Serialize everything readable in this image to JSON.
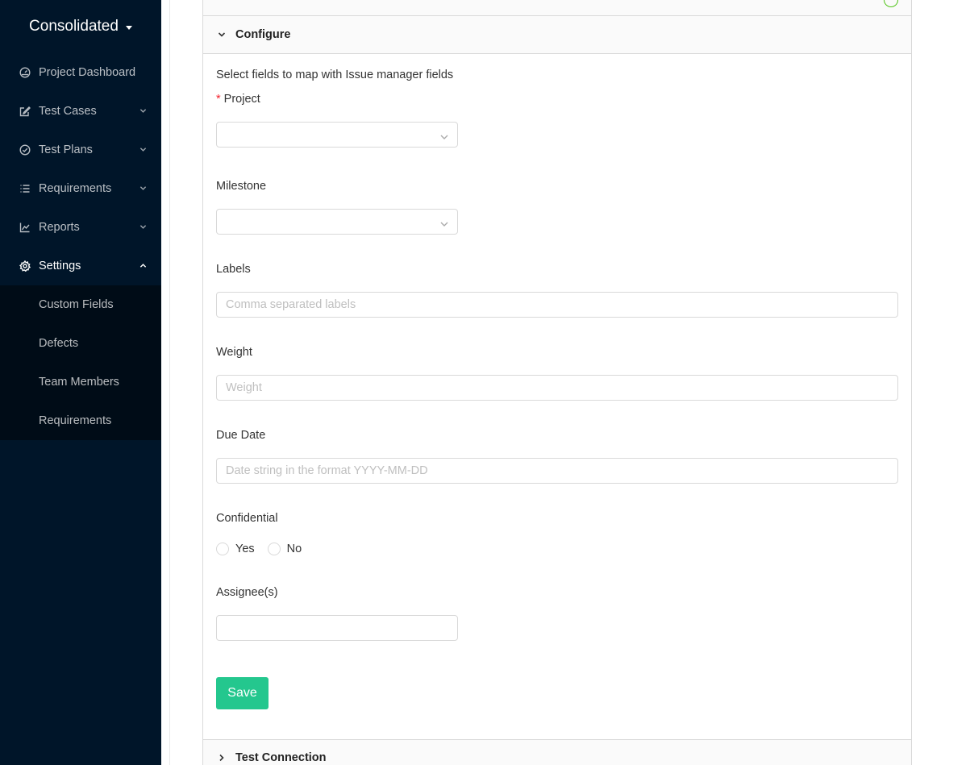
{
  "sidebar": {
    "workspace": "Consolidated",
    "items": [
      {
        "label": "Project Dashboard",
        "icon": "dashboard-icon"
      },
      {
        "label": "Test Cases",
        "icon": "edit-icon"
      },
      {
        "label": "Test Plans",
        "icon": "check-circle-icon"
      },
      {
        "label": "Requirements",
        "icon": "list-icon"
      },
      {
        "label": "Reports",
        "icon": "line-chart-icon"
      },
      {
        "label": "Settings",
        "icon": "gear-icon"
      }
    ],
    "settings_submenu": [
      "Custom Fields",
      "Defects",
      "Team Members",
      "Requirements"
    ]
  },
  "configure": {
    "title": "Configure",
    "intro": "Select fields to map with Issue manager fields",
    "project_label": "Project",
    "project_value": "",
    "milestone_label": "Milestone",
    "milestone_value": "",
    "labels_label": "Labels",
    "labels_placeholder": "Comma separated labels",
    "weight_label": "Weight",
    "weight_placeholder": "Weight",
    "due_date_label": "Due Date",
    "due_date_placeholder": "Date string in the format YYYY-MM-DD",
    "confidential_label": "Confidential",
    "confidential_options": [
      "Yes",
      "No"
    ],
    "assignees_label": "Assignee(s)",
    "assignees_value": "",
    "save_label": "Save"
  },
  "test_connection": {
    "title": "Test Connection"
  },
  "colors": {
    "sidebar_bg": "#001529",
    "submenu_bg": "#000c17",
    "save_button": "#24c78e",
    "required_marker": "#f5222d",
    "success_icon": "#52c41a"
  }
}
